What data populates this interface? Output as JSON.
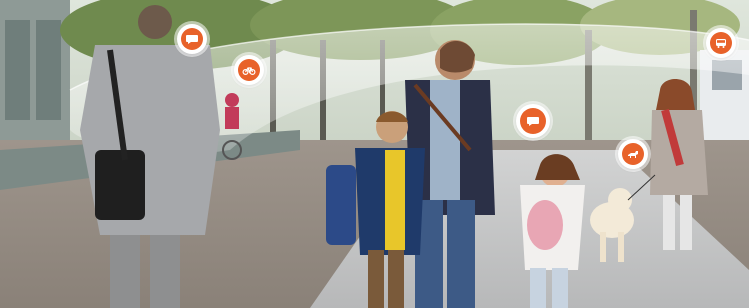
{
  "scene": {
    "description_hidden": false
  },
  "markers": [
    {
      "name": "speech-bubble-icon",
      "color": "#e8622a"
    },
    {
      "name": "bicycle-icon",
      "color": "#e8622a"
    },
    {
      "name": "speech-bubble-icon",
      "color": "#e8622a"
    },
    {
      "name": "dog-icon",
      "color": "#e8622a"
    },
    {
      "name": "bus-icon",
      "color": "#e8622a"
    }
  ],
  "colors": {
    "accent": "#e8622a",
    "sensor_band": "#ffffff"
  }
}
